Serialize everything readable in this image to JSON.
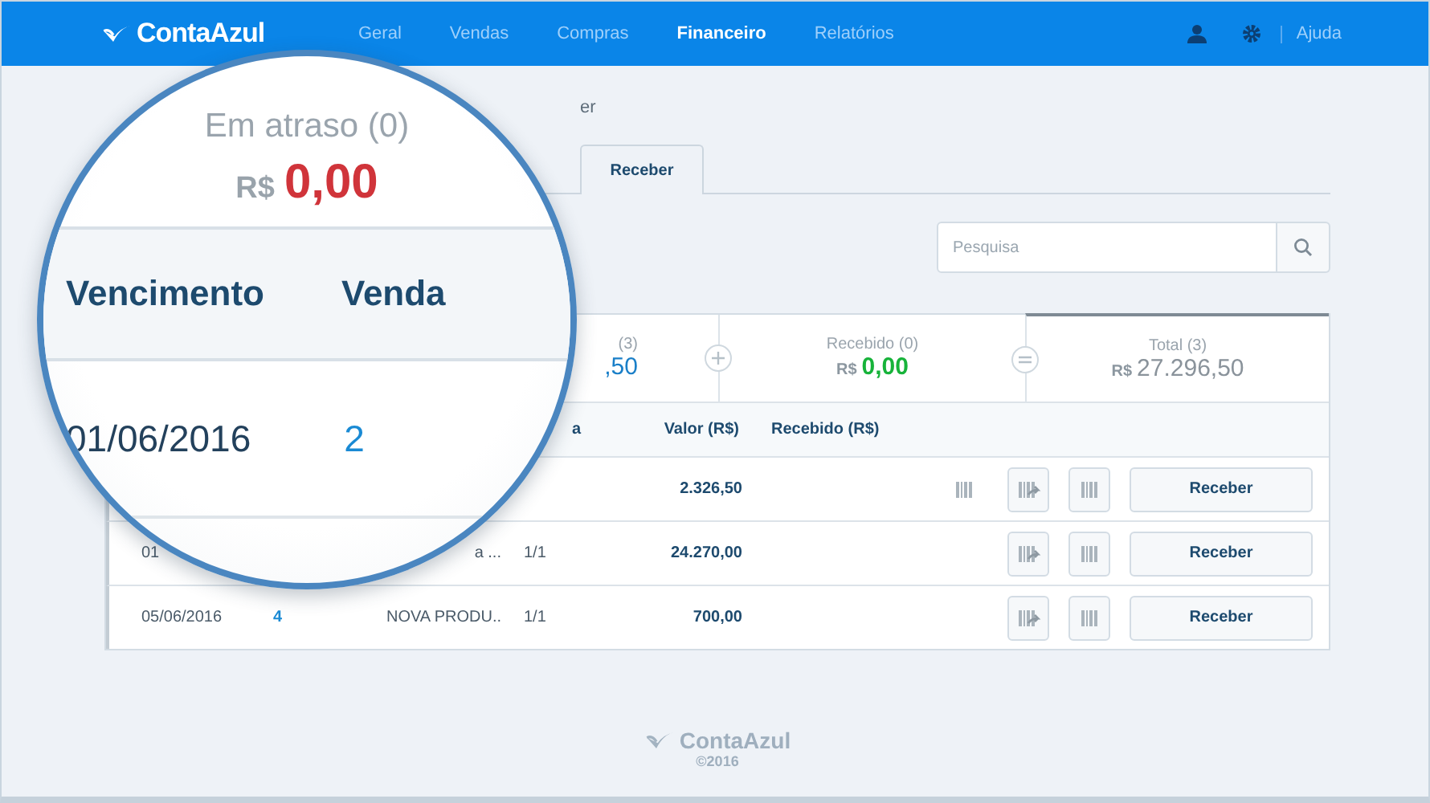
{
  "top_bar": {
    "logo": "ContaAzul",
    "nav": [
      {
        "label": "Geral",
        "selected": false
      },
      {
        "label": "Vendas",
        "selected": false
      },
      {
        "label": "Compras",
        "selected": false
      },
      {
        "label": "Financeiro",
        "selected": true
      },
      {
        "label": "Relatórios",
        "selected": false
      }
    ],
    "help": "Ajuda"
  },
  "breadcrumb": "er",
  "tab": {
    "label": "Receber",
    "selected": true
  },
  "search": {
    "placeholder": "Pesquisa"
  },
  "summary": [
    {
      "kind": "partial",
      "label": "(3)",
      "amount": ",50",
      "color": "#1a7fc8"
    },
    {
      "kind": "card",
      "label": "Recebido (0)",
      "currency": "R$",
      "amount": "0,00",
      "color": "#17b33a"
    },
    {
      "kind": "total",
      "label": "Total (3)",
      "currency": "R$",
      "amount": "27.296,50",
      "color": "#8a939b"
    }
  ],
  "table": {
    "columns": [
      {
        "label": "a"
      },
      {
        "label": "Valor (R$)"
      },
      {
        "label": "Recebido (R$)"
      }
    ],
    "rows": [
      {
        "value": "2.326,50",
        "boleto": true,
        "action": "Receber"
      },
      {
        "due": "01",
        "description": "a ...",
        "installment": "1/1",
        "value": "24.270,00",
        "boleto": false,
        "action": "Receber"
      },
      {
        "due": "05/06/2016",
        "sale": "4",
        "description": "NOVA PRODU..",
        "installment": "1/1",
        "value": "700,00",
        "boleto": false,
        "action": "Receber"
      }
    ]
  },
  "magnifier": {
    "label": "Em atraso (0)",
    "currency": "R$",
    "amount": "0,00",
    "columns": [
      "Vencimento",
      "Venda"
    ],
    "row": [
      "01/06/2016",
      "2"
    ]
  },
  "footer": {
    "logo": "ContaAzul",
    "copyright": "©2016"
  }
}
